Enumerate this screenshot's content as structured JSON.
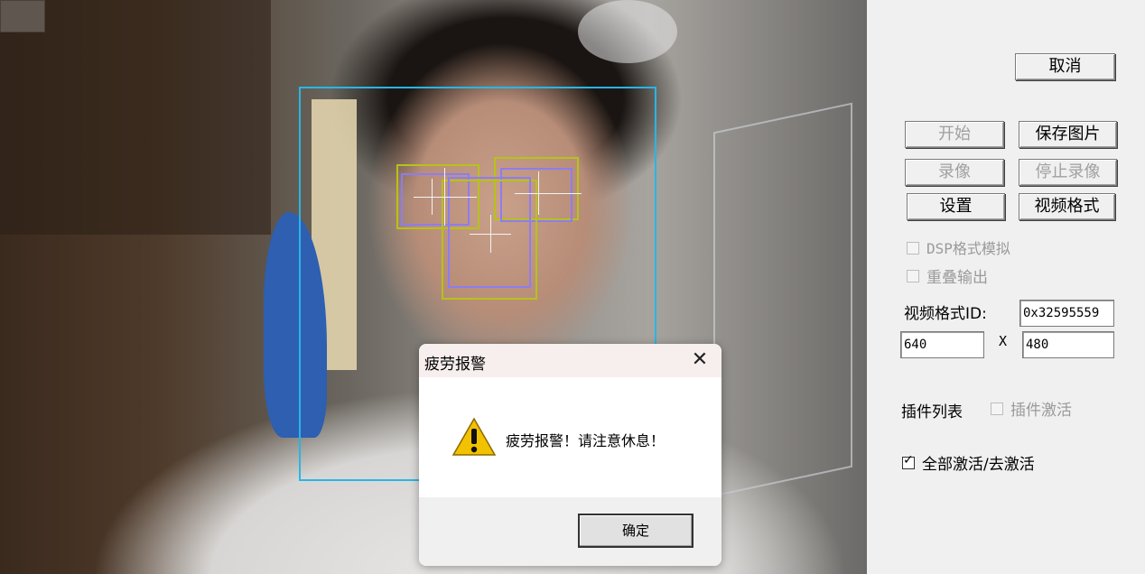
{
  "dialog": {
    "title": "疲劳报警",
    "message": "疲劳报警！请注意休息！",
    "ok_label": "确定",
    "close_glyph": "✕"
  },
  "panel": {
    "cancel_label": "取消",
    "start_label": "开始",
    "save_image_label": "保存图片",
    "record_label": "录像",
    "stop_record_label": "停止录像",
    "settings_label": "设置",
    "video_format_label": "视频格式",
    "dsp_format_label": "DSP格式模拟",
    "overlay_output_label": "重叠输出",
    "format_id_label": "视频格式ID:",
    "format_id_value": "0x32595559",
    "width_value": "640",
    "x_label": "X",
    "height_value": "480",
    "plugin_list_label": "插件列表",
    "plugin_activate_label": "插件激活",
    "activate_all_label": "全部激活/去激活"
  },
  "colors": {
    "face_box": "#27b6e6",
    "feature_box_yellow": "#b7c21a",
    "feature_box_purple": "#8e7cf0",
    "warning_icon": "#f2c200"
  },
  "icons": {
    "warning": "warning-icon",
    "close": "close-icon"
  }
}
